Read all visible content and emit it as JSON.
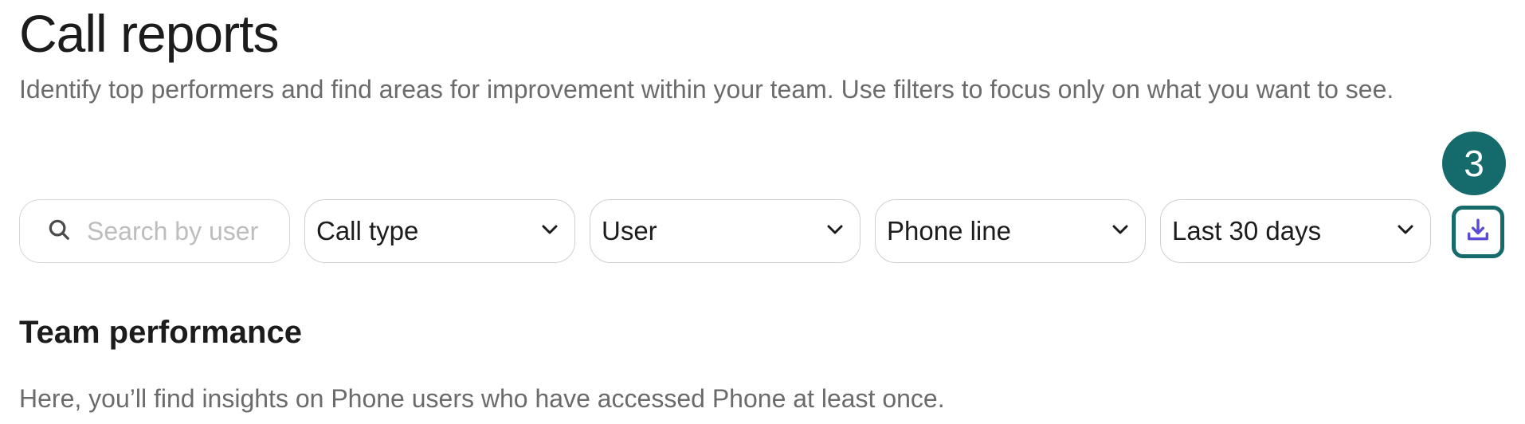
{
  "header": {
    "title": "Call reports",
    "description": "Identify top performers and find areas for improvement within your team. Use filters to focus only on what you want to see."
  },
  "filters": {
    "search": {
      "placeholder": "Search by user",
      "value": ""
    },
    "call_type": {
      "label": "Call type"
    },
    "user": {
      "label": "User"
    },
    "phone_line": {
      "label": "Phone line"
    },
    "date_range": {
      "label": "Last 30 days"
    },
    "download": {
      "icon": "download-icon"
    }
  },
  "step_badge": {
    "number": "3"
  },
  "team_performance": {
    "title": "Team performance",
    "description": "Here, you’ll find insights on Phone users who have accessed Phone at least once."
  },
  "colors": {
    "accent": "#156b6b",
    "download_icon": "#5b4bd6",
    "muted_text": "#6b6b6b",
    "border": "#d6d6d6"
  }
}
